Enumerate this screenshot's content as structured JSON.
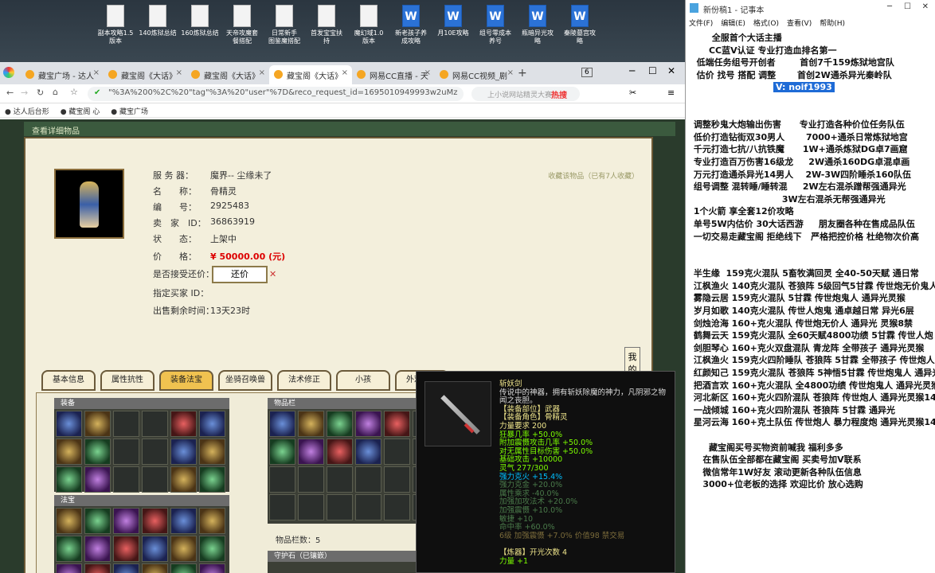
{
  "desktop": {
    "icons": [
      {
        "label": "副本攻略1.5\n版本",
        "type": "doc"
      },
      {
        "label": "140炼狱总结",
        "type": "doc"
      },
      {
        "label": "160炼狱总结",
        "type": "doc"
      },
      {
        "label": "天帝攻魔套\n餐搭配",
        "type": "doc"
      },
      {
        "label": "日常新手\n图鉴魔搭配",
        "type": "doc"
      },
      {
        "label": "首发宝宝扶\n持",
        "type": "doc"
      },
      {
        "label": "魔幻域1.0\n版本",
        "type": "doc"
      },
      {
        "label": "新老孩子养\n成攻略",
        "type": "word"
      },
      {
        "label": "月10E攻略",
        "type": "word"
      },
      {
        "label": "组号零成本\n养号",
        "type": "word"
      },
      {
        "label": "瓶暗异光攻\n略",
        "type": "word"
      },
      {
        "label": "秦陵墓宫攻\n略",
        "type": "word"
      }
    ]
  },
  "browser": {
    "tabs": [
      {
        "title": "藏宝广场 - 达人"
      },
      {
        "title": "藏宝阁《大话》"
      },
      {
        "title": "藏宝阁《大话》"
      },
      {
        "title": "藏宝阁《大话》"
      },
      {
        "title": "网易CC直播 - 天"
      },
      {
        "title": "网易CC视频_剧"
      }
    ],
    "tab_count": "6",
    "url": "\"%3A%200%2C%20\"tag\"%3A%20\"user\"%7D&reco_request_id=1695010949993w2uMz",
    "search_placeholder": "上小说网站精灵大赛",
    "hot_label": "热搜",
    "bookmarks": [
      "达人后台形",
      "藏宝阁 心",
      "藏宝广场"
    ]
  },
  "item": {
    "header": "查看详细物品",
    "fav_text": "收藏该物品（已有7人收藏）",
    "fields": [
      {
        "label": "服 务 器：",
        "value": "魔界-- 尘缘未了"
      },
      {
        "label": "名　　称：",
        "value": "骨精灵"
      },
      {
        "label": "编　　号：",
        "value": "2925483"
      },
      {
        "label": "卖　家　ID：",
        "value": "36863919"
      },
      {
        "label": "状　　态：",
        "value": "上架中"
      },
      {
        "label": "价　　格：",
        "value": "¥ 50000.00 (元)"
      },
      {
        "label": "是否接受还价：",
        "value": ""
      },
      {
        "label": "指定买家 ID：",
        "value": ""
      },
      {
        "label": "出售剩余时间：",
        "value": "13天23时"
      }
    ],
    "offer_button": "还价",
    "side_tab": "我的收藏",
    "tabs": [
      "基本信息",
      "属性抗性",
      "装备法宝",
      "坐骑召唤兽",
      "法术修正",
      "小孩",
      "外观道具"
    ],
    "active_tab": "装备法宝",
    "sections": {
      "equip": "装备",
      "treasure": "法宝",
      "inventory": "物品栏",
      "guard": "守护石（已镶嵌）"
    },
    "item_count": "物品栏数：5"
  },
  "tooltip": {
    "lines": [
      {
        "text": "斩妖剑",
        "color": "#f0e68c"
      },
      {
        "text": "传说中的神器，拥有斩妖除魔的神力，凡阴邪之物",
        "color": "#dddddd"
      },
      {
        "text": "闻之丧胆。",
        "color": "#dddddd"
      },
      {
        "text": "【装备部位】武器",
        "color": "#f0e68c"
      },
      {
        "text": "【装备角色】骨精灵",
        "color": "#f0e68c"
      },
      {
        "text": "力量要求 200",
        "color": "#f0e68c"
      },
      {
        "text": "狂暴几率 +50.0%",
        "color": "#7cfc00"
      },
      {
        "text": "附加震慑攻击几率 +50.0%",
        "color": "#7cfc00"
      },
      {
        "text": "对无属性目标伤害 +50.0%",
        "color": "#7cfc00"
      },
      {
        "text": "基础攻击 +10000",
        "color": "#7cfc00"
      },
      {
        "text": "灵气 277/300",
        "color": "#7cfc00"
      },
      {
        "text": "强力克火 +15.4%",
        "color": "#00bfff"
      },
      {
        "text": "强力克金 +20.0%",
        "color": "#4a7a4a"
      },
      {
        "text": "属性乘求 -40.0%",
        "color": "#4a7a4a"
      },
      {
        "text": "加强加攻法术 +20.0%",
        "color": "#4a7a4a"
      },
      {
        "text": "加强震慑 +10.0%",
        "color": "#4a7a4a"
      },
      {
        "text": "敏捷 +10",
        "color": "#4a7a4a"
      },
      {
        "text": "命中率 +60.0%",
        "color": "#4a7a4a"
      },
      {
        "text": "6级 加强震慑 +7.0% 价值98 禁交易",
        "color": "#7a6a3a"
      },
      {
        "text": "",
        "color": "#dddddd"
      },
      {
        "text": "【炼器】开光次数 4",
        "color": "#f0e68c"
      },
      {
        "text": "力量 +1",
        "color": "#7cfc00"
      }
    ]
  },
  "notepad": {
    "title": "新份稿1 - 记事本",
    "menu": [
      "文件(F)",
      "编辑(E)",
      "格式(O)",
      "查看(V)",
      "帮助(H)"
    ],
    "lines": [
      "       全服首个大话主播",
      "      CC蓝V认证 专业打造血排名第一",
      "  低端任务组号开创者        首创7千159炼狱地宫队",
      "  估价 找号 搭配 调整       首创2W通杀异光秦岭队",
      "",
      "",
      " 调整秒鬼大炮输出伤害      专业打造各种价位任务队伍",
      " 低价打造钻街双30男人       7000+通杀日常炼狱地宫",
      " 千元打造七抗/八抗铁魔      1W+通杀炼狱DG卓7画窟",
      " 专业打造百万伤害16级龙     2W通杀160DG卓混卓画",
      " 万元打造通杀异光14男人    2W-3W四阶睡杀160队伍",
      " 组号调整 混转睡/睡转混     2W左右混杀蹭帮强通异光",
      "                              3W左右混杀无帮强通异光",
      " 1个火箭 享全套12价攻略",
      " 单号5W内估价 30大话西游     朋友圈各种在售成品队伍",
      " 一切交易走藏宝阁 拒绝线下   严格把控价格 杜绝物次价高",
      "",
      "",
      " 半生缘  159克火混队 5畜牧满回灵 全40-50天赋 通日常",
      " 江枫渔火 140克火混队 苍狼阵 5级回气5甘霖 传世炮无价鬼人",
      " 雾隐云居 159克火混队 5甘霖 传世炮鬼人 通异光灵猴",
      " 岁月如歌 140克火混队 传世人炮鬼 通卓越日常 异光6层",
      " 剑烛沧海 160+克火混队 传世炮无价人 通异光 灵猴8禁",
      " 鹤舞云天 159克火混队 全60天赋4800功绩 5甘霖 传世人炮",
      " 剑胆琴心 160+克火双盘混队 青龙阵 全带孩子 通异光灵猴",
      " 江枫渔火 159克火四阶睡队 苍狼阵 5甘霖 全带孩子 传世炮人",
      " 红颜知己 159克火混队 苍狼阵 5神悟5甘霖 传世炮鬼人 通异光",
      " 把酒言欢 160+克火混队 全4800功绩 传世炮鬼人 通异光灵猴",
      " 河北新区 160+克火四阶混队 苍狼阵 传世炮人 通异光灵猴14",
      " 一战倾城 160+克火四阶混队 苍狼阵 5甘霖 通异光",
      " 星河云海 160+克土队伍 传世炮人 暴力程度炮 通异光灵猴14",
      "",
      "      藏宝阁买号买物资前喊我 福利多多",
      "    在售队伍全部都在藏宝阁 买卖号加V联系",
      "    微信常年1W好友 滚动更新各种队伍信息",
      "    3000+位老板的选择 欢迎比价 放心选购"
    ],
    "highlight": "V: noif1993"
  }
}
